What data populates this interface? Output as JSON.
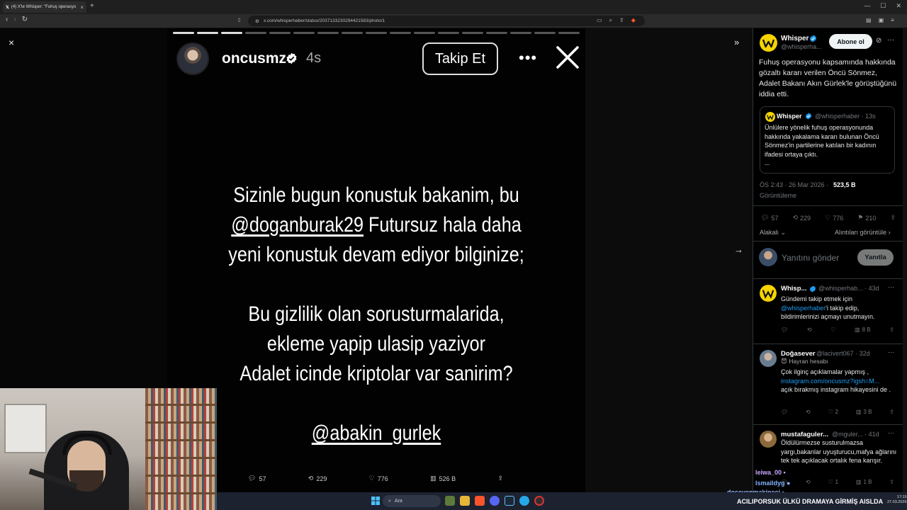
{
  "browser": {
    "tab_title": "(4) X'te Whisper: \"Fuhuş operasyo",
    "tab_close": "×",
    "new_tab": "+",
    "url": "x.com/whisperhaber/status/2037133230294421583/photo/1"
  },
  "viewer": {
    "close_glyph": "×",
    "collapse_glyph": "»",
    "next_glyph": "→",
    "progress": {
      "total_segments": 17,
      "completed": 3
    }
  },
  "story": {
    "username": "oncusmz",
    "time": "4s",
    "follow_label": "Takip Et",
    "more_glyph": "•••",
    "lines": [
      {
        "text": "Sizinle bugun konustuk bakanim, bu",
        "mention": false
      },
      {
        "text": "@doganburak29",
        "mention": true,
        "suffix": " Futursuz hala daha"
      },
      {
        "text": "yeni konustuk devam ediyor bilginize;",
        "mention": false
      },
      {
        "text": "",
        "mention": false
      },
      {
        "text": "Bu gizlilik olan sorusturmalarida,",
        "mention": false
      },
      {
        "text": "ekleme yapip ulasip yaziyor",
        "mention": false
      },
      {
        "text": "Adalet icinde kriptolar var sanirim?",
        "mention": false
      },
      {
        "text": "",
        "mention": false
      },
      {
        "text": "@abakin_gurlek",
        "mention": true
      }
    ]
  },
  "bottom_stats": {
    "replies": "57",
    "reposts": "229",
    "likes": "776",
    "views": "526 B"
  },
  "sidebar": {
    "author": "Whisper",
    "handle": "@whisperha...",
    "follow_label": "Abone ol",
    "more_glyph": "···",
    "text": "Fuhuş operasyonu kapsamında hakkında gözaltı kararı verilen Öncü Sönmez, Adalet Bakanı Akın Gürlek'le görüştüğünü iddia etti.",
    "quote": {
      "author": "Whisper",
      "handle": "@whisperhaber",
      "time": "13s",
      "text": "Ünlülere yönelik fuhuş operasyonunda hakkında yakalama kararı bulunan Öncü Sönmez'in partilerine katılan bir kadının ifadesi ortaya çıktı.",
      "ellipsis": "..."
    },
    "meta": "ÖS 2:43 · 26 Mar 2026 ·",
    "views": "523,5 B",
    "views_label": "Görüntüleme",
    "actions": {
      "replies": "57",
      "reposts": "229",
      "likes": "776",
      "bookmarks": "210"
    },
    "related": "Alakalı",
    "quotes_link": "Alıntıları görüntüle",
    "reply_placeholder": "Yanıtını gönder",
    "reply_button": "Yanıtla",
    "replies": [
      {
        "name": "Whisp...",
        "handle": "@whisperhab...",
        "time": "43d",
        "body_pre": "Gündemi takip etmek için",
        "link": "@whisperhaber",
        "body_post": "'i takip edip, bildirimlerinizi açmayı unutmayın.",
        "stats": {
          "reposts": "",
          "likes": "",
          "views": "8 B"
        }
      },
      {
        "name": "Doğasever",
        "handle": "@lacivert067",
        "time": "32d",
        "badge": "Hayran hesabı",
        "body_pre": "Çok ilginç açıklamalar yapmış ,",
        "link": "instagram.com/oncusmz?igsh=M...",
        "body_post": "açık bırakmış instagram hikayesini de .",
        "stats": {
          "reposts": "",
          "likes": "2",
          "views": "3 B"
        }
      },
      {
        "name": "mustafaguler...",
        "handle": "@mguler...",
        "time": "41d",
        "body_pre": "Öldülürmezse susturulmazsa yargı,bakanlar uyuşturucu,mafya ağlarını tek tek açıklacak ortalık fena karışır.",
        "link": "",
        "body_post": "",
        "stats": {
          "reposts": "",
          "likes": "1",
          "views": "1 B"
        }
      }
    ]
  },
  "chat": [
    {
      "user": "leiwa_00",
      "color": "#c9a6ff"
    },
    {
      "user": "lsmaildyg",
      "color": "#7fb2ff"
    },
    {
      "user": "doseyenmakineci",
      "color": "#9ab8ff"
    }
  ],
  "ticker": "ACILIPORSUK  ÜLKÜ DRAMAYA GİRMİŞ AISLDA",
  "taskbar": {
    "search_label": "Ara",
    "time": "17:15",
    "date": "27.03.2026"
  },
  "colors": {
    "accent": "#1d9bf0",
    "verified": "#1d9bf0",
    "whisper_logo": "#f5d400"
  }
}
